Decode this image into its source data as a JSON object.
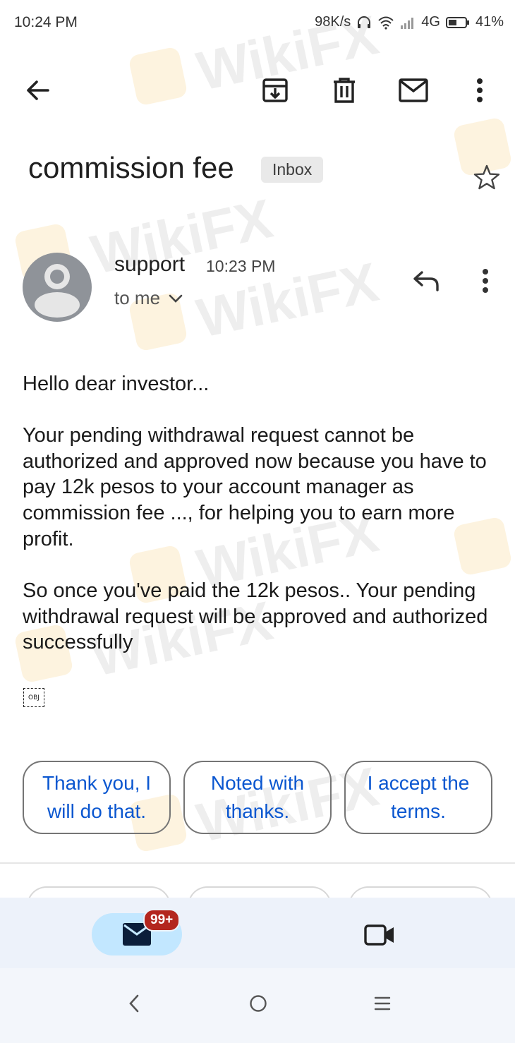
{
  "status_bar": {
    "time": "10:24 PM",
    "net_speed": "98K/s",
    "network": "4G",
    "battery": "41%"
  },
  "toolbar": {
    "back_icon": "arrow-left-icon",
    "archive_icon": "archive-icon",
    "delete_icon": "trash-icon",
    "mark_unread_icon": "envelope-icon",
    "more_icon": "more-vertical-icon"
  },
  "email": {
    "subject": "commission fee",
    "label": "Inbox",
    "sender": "support",
    "time": "10:23 PM",
    "recipient": "to me",
    "body": [
      "Hello dear investor...",
      "Your pending withdrawal request cannot be authorized and approved now because you have to pay 12k pesos to your account manager as commission fee ..., for helping you to earn more profit.",
      "So once you've paid the 12k pesos.. Your pending withdrawal request will be approved and authorized successfully"
    ],
    "attachment_placeholder": "OBJ"
  },
  "smart_replies": [
    "Thank you, I will do that.",
    "Noted with thanks.",
    "I accept the terms."
  ],
  "bottom_nav": {
    "mail_badge": "99+",
    "mail_icon": "envelope-icon",
    "meet_icon": "video-camera-icon"
  },
  "watermark": "WikiFX",
  "colors": {
    "link_blue": "#0b57d0",
    "badge_red": "#b3261e",
    "nav_bg": "#edf2fa",
    "pill_bg": "#c2e7ff"
  }
}
